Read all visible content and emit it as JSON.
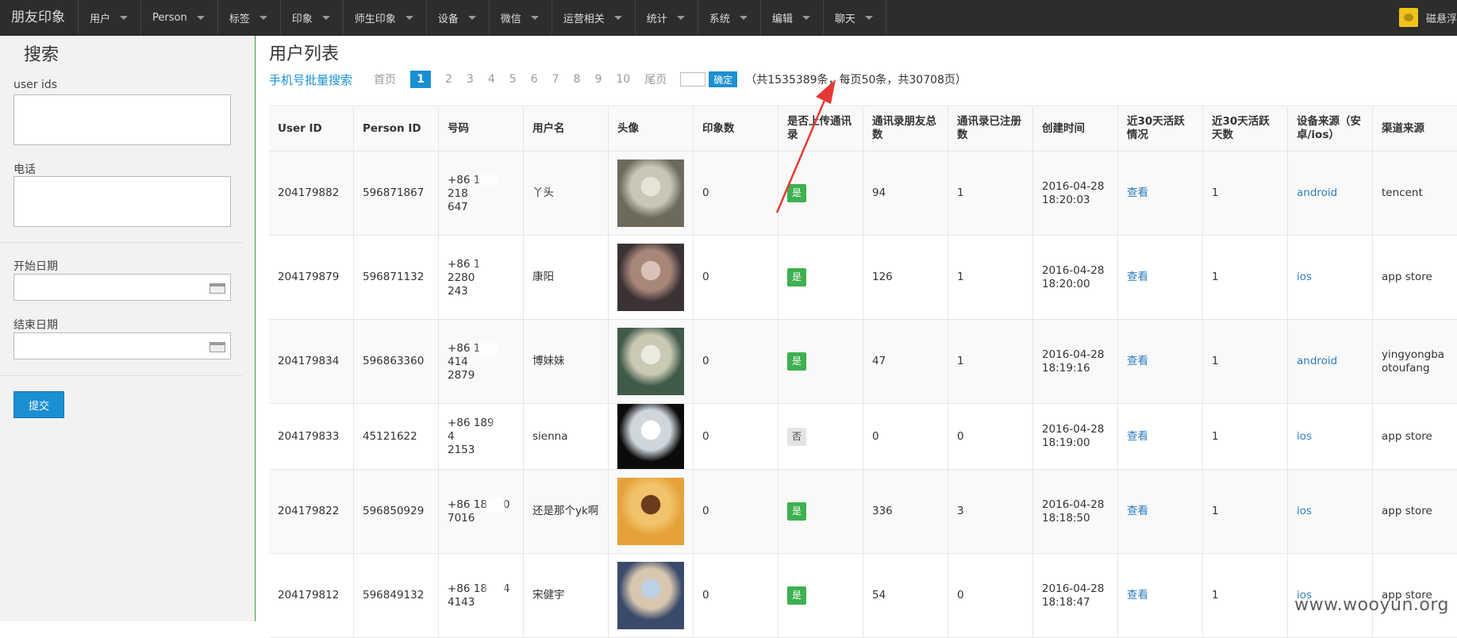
{
  "brand": "朋友印象",
  "menu": [
    "用户",
    "Person",
    "标签",
    "印象",
    "师生印象",
    "设备",
    "微信",
    "运营相关",
    "统计",
    "系统",
    "编辑",
    "聊天"
  ],
  "user_name": "磁悬浮",
  "sidebar": {
    "title": "搜索",
    "user_ids_label": "user ids",
    "phone_label": "电话",
    "start_label": "开始日期",
    "end_label": "结束日期",
    "submit": "提交"
  },
  "main": {
    "title": "用户列表",
    "batch_search": "手机号批量搜索",
    "first": "首页",
    "pages": [
      "1",
      "2",
      "3",
      "4",
      "5",
      "6",
      "7",
      "8",
      "9",
      "10"
    ],
    "active_page": "1",
    "last": "尾页",
    "go": "确定",
    "summary": "（共1535389条，每页50条，共30708页）"
  },
  "table": {
    "headers": [
      "User ID",
      "Person ID",
      "号码",
      "用户名",
      "头像",
      "印象数",
      "是否上传通讯录",
      "通讯录朋友总数",
      "通讯录已注册数",
      "创建时间",
      "近30天活跃情况",
      "近30天活跃天数",
      "设备来源（安卓/ios）",
      "渠道来源"
    ],
    "rows": [
      {
        "uid": "204179882",
        "pid": "596871867",
        "phone_a": "+86 1",
        "phone_b": "218",
        "phone_c": "647",
        "name": "丫头",
        "impressions": "0",
        "uploaded": "是",
        "friends": "94",
        "registered": "1",
        "created": "2016-04-28 18:20:03",
        "active": "查看",
        "days": "1",
        "device": "android",
        "channel": "tencent"
      },
      {
        "uid": "204179879",
        "pid": "596871132",
        "phone_a": "+86 1",
        "phone_b": "2280",
        "phone_c": "243",
        "name": "康阳",
        "impressions": "0",
        "uploaded": "是",
        "friends": "126",
        "registered": "1",
        "created": "2016-04-28 18:20:00",
        "active": "查看",
        "days": "1",
        "device": "ios",
        "channel": "app store"
      },
      {
        "uid": "204179834",
        "pid": "596863360",
        "phone_a": "+86 1",
        "phone_b": "414",
        "phone_c": "2879",
        "name": "博妹妹",
        "impressions": "0",
        "uploaded": "是",
        "friends": "47",
        "registered": "1",
        "created": "2016-04-28 18:19:16",
        "active": "查看",
        "days": "1",
        "device": "android",
        "channel": "yingyongbaotoufang"
      },
      {
        "uid": "204179833",
        "pid": "45121622",
        "phone_a": "+86 189",
        "phone_b": "4",
        "phone_c": "2153",
        "name": "sienna",
        "impressions": "0",
        "uploaded": "否",
        "friends": "0",
        "registered": "0",
        "created": "2016-04-28 18:19:00",
        "active": "查看",
        "days": "1",
        "device": "ios",
        "channel": "app store"
      },
      {
        "uid": "204179822",
        "pid": "596850929",
        "phone_a": "+86 18",
        "phone_b": "0",
        "phone_c": "7016",
        "name": "还是那个yk啊",
        "impressions": "0",
        "uploaded": "是",
        "friends": "336",
        "registered": "3",
        "created": "2016-04-28 18:18:50",
        "active": "查看",
        "days": "1",
        "device": "ios",
        "channel": "app store"
      },
      {
        "uid": "204179812",
        "pid": "596849132",
        "phone_a": "+86 18",
        "phone_b": "4",
        "phone_c": "4143",
        "name": "宋健宇",
        "impressions": "0",
        "uploaded": "是",
        "friends": "54",
        "registered": "0",
        "created": "2016-04-28 18:18:47",
        "active": "查看",
        "days": "1",
        "device": "ios",
        "channel": "app store"
      }
    ]
  },
  "watermark": "www.wooyun.org",
  "colors": {
    "accent": "#1b8fd3",
    "yes": "#3eb04f",
    "annotation": "#e53935"
  }
}
